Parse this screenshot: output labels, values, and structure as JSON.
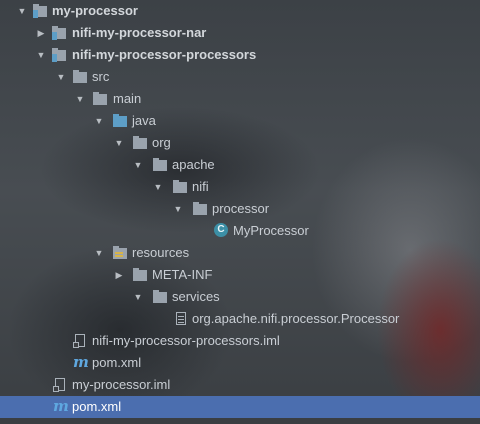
{
  "tree": {
    "items": [
      {
        "label": "my-processor",
        "icon": "module-folder-icon",
        "expanded": true
      },
      {
        "label": "nifi-my-processor-nar",
        "icon": "module-folder-icon",
        "expanded": false
      },
      {
        "label": "nifi-my-processor-processors",
        "icon": "module-folder-icon",
        "expanded": true
      },
      {
        "label": "src",
        "icon": "folder-icon",
        "expanded": true
      },
      {
        "label": "main",
        "icon": "folder-icon",
        "expanded": true
      },
      {
        "label": "java",
        "icon": "source-folder-icon",
        "expanded": true
      },
      {
        "label": "org",
        "icon": "package-icon",
        "expanded": true
      },
      {
        "label": "apache",
        "icon": "package-icon",
        "expanded": true
      },
      {
        "label": "nifi",
        "icon": "package-icon",
        "expanded": true
      },
      {
        "label": "processor",
        "icon": "package-icon",
        "expanded": true
      },
      {
        "label": "MyProcessor",
        "icon": "java-class-icon"
      },
      {
        "label": "resources",
        "icon": "resources-folder-icon",
        "expanded": true
      },
      {
        "label": "META-INF",
        "icon": "folder-icon",
        "expanded": false
      },
      {
        "label": "services",
        "icon": "folder-icon",
        "expanded": true
      },
      {
        "label": "org.apache.nifi.processor.Processor",
        "icon": "text-file-icon"
      },
      {
        "label": "nifi-my-processor-processors.iml",
        "icon": "iml-file-icon"
      },
      {
        "label": "pom.xml",
        "icon": "maven-icon"
      },
      {
        "label": "my-processor.iml",
        "icon": "iml-file-icon"
      },
      {
        "label": "pom.xml",
        "icon": "maven-icon",
        "selected": true
      }
    ],
    "class_badge_letter": "C",
    "maven_letter": "m",
    "colors": {
      "selection": "#4b6eaf",
      "source_folder": "#5d9ec7",
      "class_badge": "#3c8fa6",
      "maven": "#5fa8e0"
    }
  }
}
